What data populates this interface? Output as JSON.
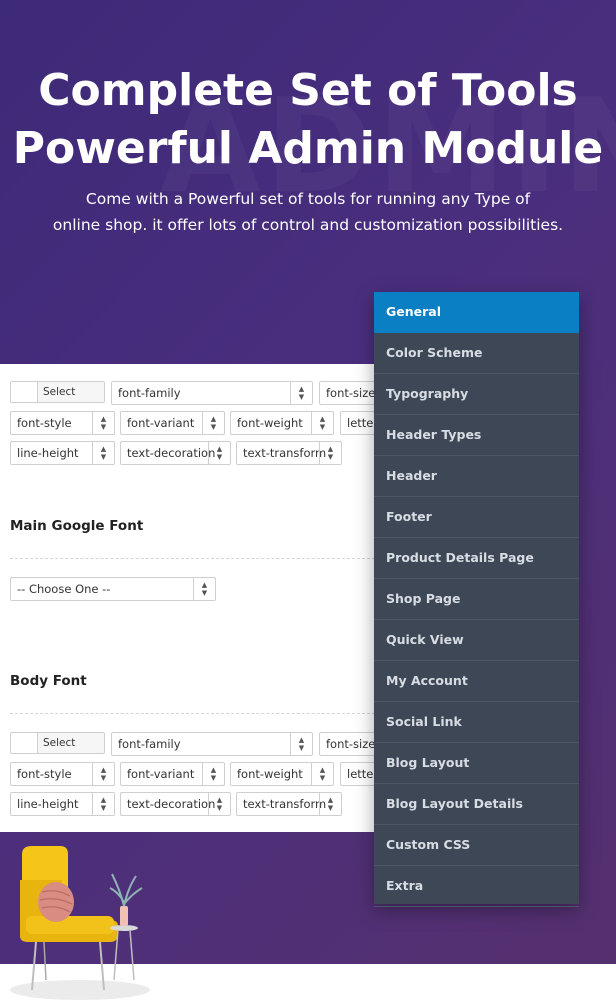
{
  "header": {
    "title_line1": "Complete Set of Tools",
    "title_line2": "Powerful Admin Module",
    "subtitle_line1": "Come with a Powerful set of tools for running any Type of",
    "subtitle_line2": "online shop. it offer lots of control and customization possibilities.",
    "watermark": "ADMIN"
  },
  "panel": {
    "top_group": {
      "select_color": "Select Color",
      "font_family": "font-family",
      "font_size": "font-size",
      "font_style": "font-style",
      "font_variant": "font-variant",
      "font_weight": "font-weight",
      "letter": "letter",
      "line_height": "line-height",
      "text_decoration": "text-decoration",
      "text_transform": "text-transform"
    },
    "main_google_font": {
      "title": "Main Google Font",
      "select_value": "-- Choose One --"
    },
    "body_font": {
      "title": "Body Font",
      "select_color": "Select Color",
      "font_family": "font-family",
      "font_size": "font-size",
      "font_style": "font-style",
      "font_variant": "font-variant",
      "font_weight": "font-weight",
      "letter": "letter",
      "line_height": "line-height",
      "text_decoration": "text-decoration",
      "text_transform": "text-transform"
    }
  },
  "menu": {
    "items": [
      {
        "label": "General",
        "active": true
      },
      {
        "label": "Color Scheme"
      },
      {
        "label": "Typography"
      },
      {
        "label": "Header Types"
      },
      {
        "label": "Header"
      },
      {
        "label": "Footer"
      },
      {
        "label": "Product Details Page"
      },
      {
        "label": "Shop Page"
      },
      {
        "label": "Quick View"
      },
      {
        "label": "My Account"
      },
      {
        "label": "Social Link"
      },
      {
        "label": "Blog Layout"
      },
      {
        "label": "Blog Layout Details"
      },
      {
        "label": "Custom CSS"
      },
      {
        "label": "Extra"
      }
    ]
  },
  "colors": {
    "background": "#4a2e7e",
    "menu_bg": "#3d4756",
    "menu_active": "#0b7fc4",
    "chair": "#f5c518"
  }
}
